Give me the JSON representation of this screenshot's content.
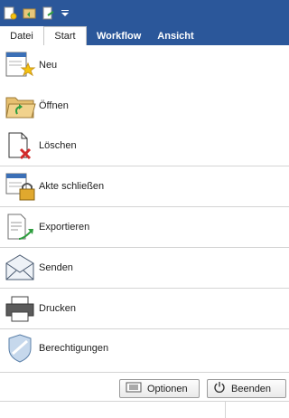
{
  "qat": {
    "icons": [
      "new-document-icon",
      "open-folder-icon",
      "export-icon",
      "customize-dropdown-icon"
    ]
  },
  "tabs": {
    "file": "Datei",
    "start": "Start",
    "workflow": "Workflow",
    "view": "Ansicht"
  },
  "menu": {
    "items": [
      {
        "label": "Neu",
        "icon": "new-icon"
      },
      {
        "label": "Öffnen",
        "icon": "open-icon"
      },
      {
        "label": "Löschen",
        "icon": "delete-icon"
      },
      {
        "label": "Akte schließen",
        "icon": "close-file-icon"
      },
      {
        "label": "Exportieren",
        "icon": "export-icon"
      },
      {
        "label": "Senden",
        "icon": "send-icon"
      },
      {
        "label": "Drucken",
        "icon": "print-icon"
      },
      {
        "label": "Berechtigungen",
        "icon": "permissions-icon"
      }
    ]
  },
  "buttons": {
    "options": "Optionen",
    "quit": "Beenden"
  },
  "colors": {
    "ribbon": "#2b579a",
    "accent_green": "#2e9d3f",
    "delete_red": "#d22a2a"
  }
}
